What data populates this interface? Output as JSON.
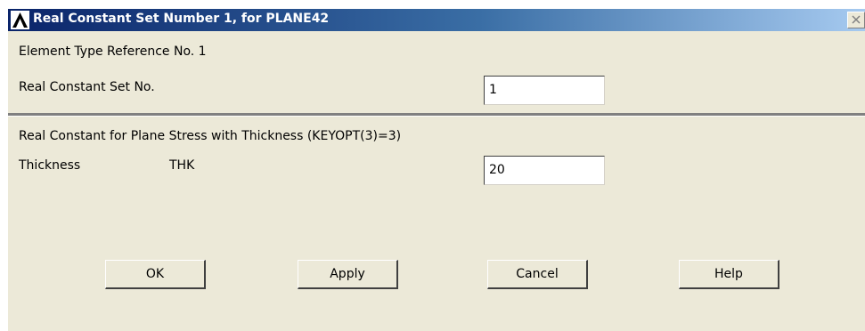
{
  "window": {
    "title": "Real Constant Set Number 1, for PLANE42",
    "app_icon": "ansys-logo-icon",
    "close_icon": "close-icon"
  },
  "form": {
    "element_type_ref": "Element Type Reference No. 1",
    "real_constant_set_label": "Real Constant Set No.",
    "real_constant_set_value": "1",
    "section_heading": "Real Constant for Plane Stress with Thickness (KEYOPT(3)=3)",
    "thickness_label": "Thickness",
    "thickness_symbol": "THK",
    "thickness_value": "20"
  },
  "buttons": {
    "ok": "OK",
    "apply": "Apply",
    "cancel": "Cancel",
    "help": "Help"
  },
  "colors": {
    "titlebar_start": "#0a246a",
    "titlebar_end": "#a6caf0",
    "dialog_bg": "#ece9d8"
  }
}
